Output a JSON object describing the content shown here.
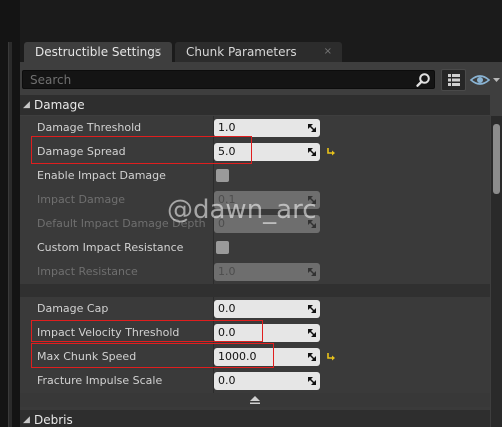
{
  "tabs": [
    {
      "label": "Destructible Settings",
      "close": "×"
    },
    {
      "label": "Chunk Parameters",
      "close": "×"
    }
  ],
  "search": {
    "placeholder": "Search",
    "value": ""
  },
  "sections": {
    "damage": {
      "title": "Damage"
    },
    "debris": {
      "title": "Debris"
    }
  },
  "rows": [
    {
      "label": "Damage Threshold",
      "value": "1.0",
      "enabled": true
    },
    {
      "label": "Damage Spread",
      "value": "5.0",
      "enabled": true,
      "modified": true
    },
    {
      "label": "Enable Impact Damage",
      "checked": false,
      "enabled": true
    },
    {
      "label": "Impact Damage",
      "value": "0.1",
      "enabled": false
    },
    {
      "label": "Default Impact Damage Depth",
      "value": "0",
      "enabled": false
    },
    {
      "label": "Custom Impact Resistance",
      "checked": false,
      "enabled": true
    },
    {
      "label": "Impact Resistance",
      "value": "1.0",
      "enabled": false
    },
    {
      "label": "Damage Cap",
      "value": "0.0",
      "enabled": true
    },
    {
      "label": "Impact Velocity Threshold",
      "value": "0.0",
      "enabled": true
    },
    {
      "label": "Max Chunk Speed",
      "value": "1000.0",
      "enabled": true,
      "modified": true
    },
    {
      "label": "Fracture Impulse Scale",
      "value": "0.0",
      "enabled": true
    }
  ],
  "watermark": "@dawn_arc",
  "colors": {
    "highlight": "#e01e1e",
    "reset_arrow": "#e8c21a"
  }
}
